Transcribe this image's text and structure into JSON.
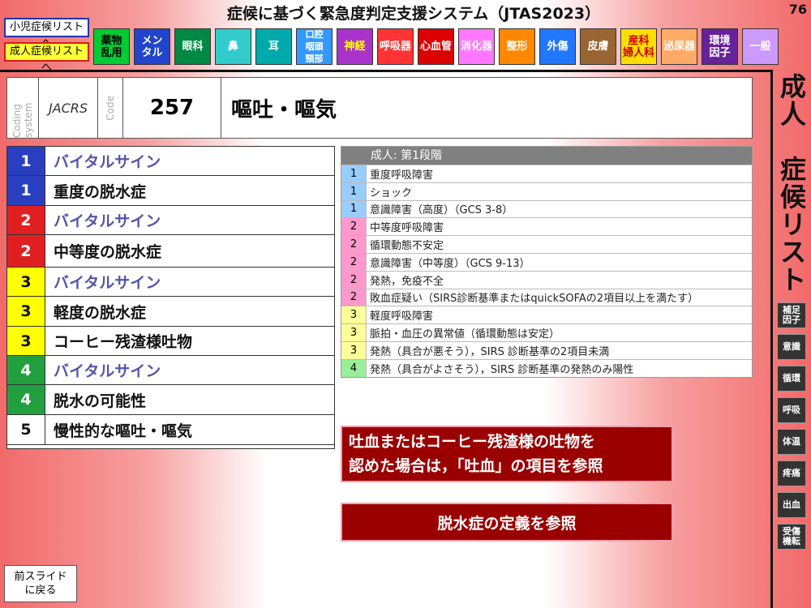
{
  "header": {
    "title": "症候に基づく緊急度判定支援システム（JTAS2023）",
    "page_number": "76",
    "nav": {
      "pediatric": "小児症候リストへ",
      "adult": "成人症候リストへ"
    }
  },
  "categories": [
    {
      "label": "薬物\n乱用",
      "bg": "#00cc33",
      "fg": "#000000"
    },
    {
      "label": "メン\nタル",
      "bg": "#2244cc",
      "fg": "#ffffff"
    },
    {
      "label": "眼科",
      "bg": "#008844",
      "fg": "#ffffff"
    },
    {
      "label": "鼻",
      "bg": "#33cccc",
      "fg": "#ffffff"
    },
    {
      "label": "耳",
      "bg": "#00aaaa",
      "fg": "#ffffff"
    },
    {
      "label": "口腔\n咽頭\n頸部",
      "bg": "#3399ff",
      "fg": "#ffffff"
    },
    {
      "label": "神経",
      "bg": "#aa33cc",
      "fg": "#ffff00"
    },
    {
      "label": "呼吸器",
      "bg": "#ff3333",
      "fg": "#ffffff"
    },
    {
      "label": "心血管",
      "bg": "#dd0000",
      "fg": "#ffffff"
    },
    {
      "label": "消化器",
      "bg": "#ff77ff",
      "fg": "#ffffff"
    },
    {
      "label": "整形",
      "bg": "#ff8800",
      "fg": "#ffffff"
    },
    {
      "label": "外傷",
      "bg": "#2277ff",
      "fg": "#ffffff"
    },
    {
      "label": "皮膚",
      "bg": "#996633",
      "fg": "#ffffff"
    },
    {
      "label": "産科\n婦人科",
      "bg": "#ffdd00",
      "fg": "#cc0000"
    },
    {
      "label": "泌尿器",
      "bg": "#ffaa66",
      "fg": "#ffffff"
    },
    {
      "label": "環境\n因子",
      "bg": "#662299",
      "fg": "#ffffff"
    },
    {
      "label": "一般",
      "bg": "#cc99ff",
      "fg": "#ffffff"
    }
  ],
  "sidebar": {
    "title": "成人\n\n症候リスト",
    "buttons": [
      "補足\n因子",
      "意識",
      "循環",
      "呼吸",
      "体温",
      "疼痛",
      "出血",
      "受傷\n機転"
    ]
  },
  "code_box": {
    "system_label": "Coding system",
    "system_value": "JACRS",
    "code_label": "Code",
    "code_value": "257",
    "complaint": "嘔吐・嘔気"
  },
  "symptom_rows": [
    {
      "level": "1",
      "text": "バイタルサイン",
      "color": "#2a3fbf",
      "num_color": "#ffffff",
      "text_color": "#5555aa"
    },
    {
      "level": "1",
      "text": "重度の脱水症",
      "color": "#2a3fbf",
      "num_color": "#ffffff",
      "text_color": "#111111"
    },
    {
      "level": "2",
      "text": "バイタルサイン",
      "color": "#e02020",
      "num_color": "#ffffff",
      "text_color": "#5555aa"
    },
    {
      "level": "2",
      "text": "中等度の脱水症",
      "color": "#e02020",
      "num_color": "#ffffff",
      "text_color": "#111111"
    },
    {
      "level": "3",
      "text": "バイタルサイン",
      "color": "#ffff00",
      "num_color": "#111111",
      "text_color": "#5555aa"
    },
    {
      "level": "3",
      "text": "軽度の脱水症",
      "color": "#ffff00",
      "num_color": "#111111",
      "text_color": "#111111"
    },
    {
      "level": "3",
      "text": "コーヒー残渣様吐物",
      "color": "#ffff00",
      "num_color": "#111111",
      "text_color": "#111111"
    },
    {
      "level": "4",
      "text": "バイタルサイン",
      "color": "#22a040",
      "num_color": "#ffffff",
      "text_color": "#5555aa"
    },
    {
      "level": "4",
      "text": "脱水の可能性",
      "color": "#22a040",
      "num_color": "#ffffff",
      "text_color": "#111111"
    },
    {
      "level": "5",
      "text": "慢性的な嘔吐・嘔気",
      "color": "#ffffff",
      "num_color": "#111111",
      "text_color": "#111111"
    }
  ],
  "criteria": {
    "header": "成人: 第1段階",
    "rows": [
      {
        "level": "1",
        "text": "重度呼吸障害",
        "color": "#99ccff"
      },
      {
        "level": "1",
        "text": "ショック",
        "color": "#99ccff"
      },
      {
        "level": "1",
        "text": "意識障害（高度）（GCS 3-8）",
        "color": "#99ccff"
      },
      {
        "level": "2",
        "text": "中等度呼吸障害",
        "color": "#ff99cc"
      },
      {
        "level": "2",
        "text": "循環動態不安定",
        "color": "#ff99cc"
      },
      {
        "level": "2",
        "text": "意識障害（中等度）（GCS 9-13）",
        "color": "#ff99cc"
      },
      {
        "level": "2",
        "text": "発熱，免疫不全",
        "color": "#ff99cc"
      },
      {
        "level": "2",
        "text": "敗血症疑い（SIRS診断基準またはquickSOFAの2項目以上を満たす）",
        "color": "#ff99cc"
      },
      {
        "level": "3",
        "text": "軽度呼吸障害",
        "color": "#ffff99"
      },
      {
        "level": "3",
        "text": "脈拍・血圧の異常値（循環動態は安定）",
        "color": "#ffff99"
      },
      {
        "level": "3",
        "text": "発熱（具合が悪そう），SIRS 診断基準の2項目未満",
        "color": "#ffff99"
      },
      {
        "level": "4",
        "text": "発熱（具合がよさそう），SIRS 診断基準の発熱のみ陽性",
        "color": "#99ee99"
      }
    ]
  },
  "notes": {
    "hematemesis": "吐血またはコーヒー残渣様の吐物を\n認めた場合は，「吐血」の項目を参照",
    "dehydration": "脱水症の定義を参照"
  },
  "back_button": "前スライド\nに戻る"
}
